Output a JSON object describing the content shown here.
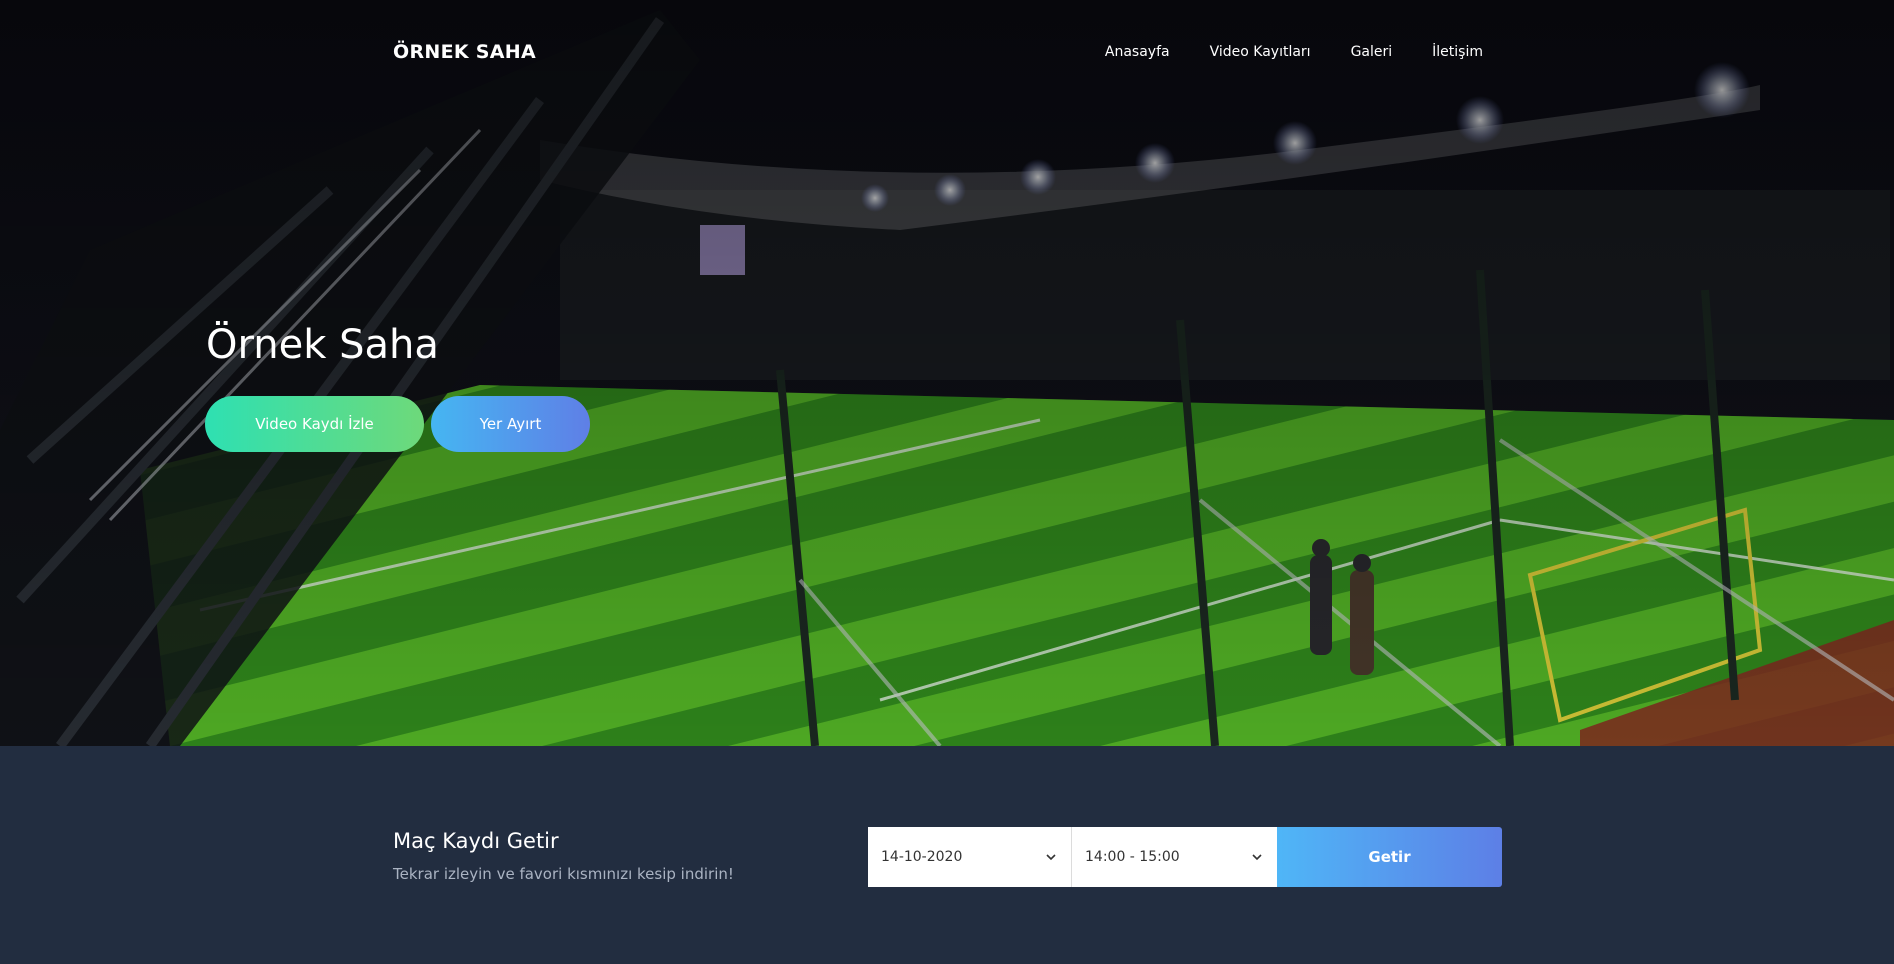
{
  "nav": {
    "brand": "ÖRNEK SAHA",
    "items": [
      "Anasayfa",
      "Video Kayıtları",
      "Galeri",
      "İletişim"
    ]
  },
  "hero": {
    "title": "Örnek Saha",
    "watch_button": "Video Kaydı İzle",
    "book_button": "Yer Ayırt"
  },
  "match_record": {
    "title": "Maç Kaydı Getir",
    "subtitle": "Tekrar izleyin ve favori kısmınızı kesip indirin!",
    "date_value": "14-10-2020",
    "time_value": "14:00 - 15:00",
    "submit_label": "Getir"
  },
  "colors": {
    "page_bg": "#222d40",
    "watch_gradient": [
      "#2ee0b2",
      "#6ed97a"
    ],
    "book_gradient": [
      "#45b6f2",
      "#5f7fe6"
    ],
    "submit_gradient": [
      "#4fb6f7",
      "#5d7fe6"
    ]
  }
}
